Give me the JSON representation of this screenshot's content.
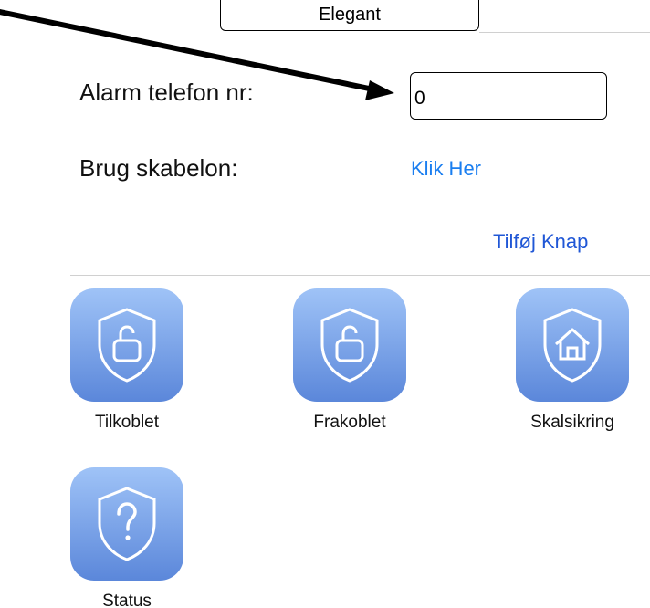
{
  "header": {
    "segment_label": "Elegant"
  },
  "form": {
    "phone_label": "Alarm telefon nr:",
    "phone_value": "0",
    "template_label": "Brug skabelon:",
    "template_link": "Klik Her",
    "add_button_link": "Tilføj Knap"
  },
  "tiles": [
    {
      "label": "Tilkoblet",
      "icon": "shield-unlock-icon"
    },
    {
      "label": "Frakoblet",
      "icon": "shield-unlock-icon"
    },
    {
      "label": "Skalsikring",
      "icon": "shield-home-icon"
    },
    {
      "label": "Status",
      "icon": "shield-question-icon"
    }
  ],
  "colors": {
    "link_light": "#1a7ef0",
    "link_dark": "#2057d6",
    "tile_gradient_top": "#9fc3f7",
    "tile_gradient_bottom": "#5b87da"
  }
}
